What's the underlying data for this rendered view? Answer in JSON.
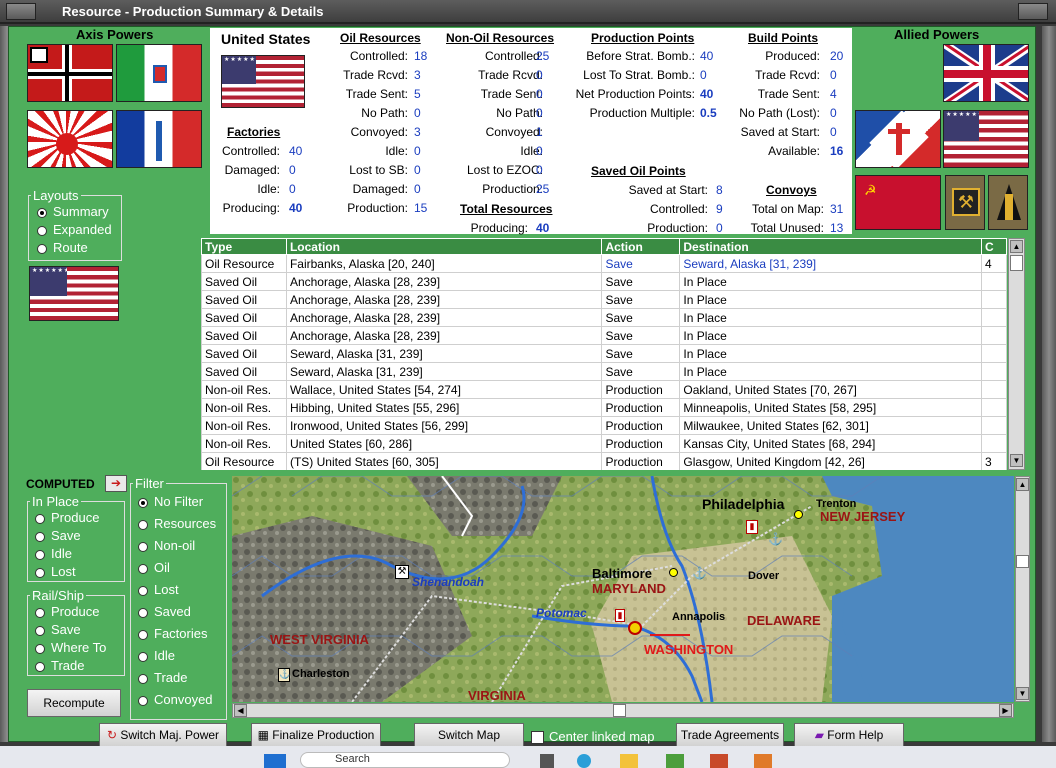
{
  "window": {
    "title": "Resource - Production Summary & Details"
  },
  "axis": {
    "title": "Axis Powers"
  },
  "allied": {
    "title": "Allied Powers"
  },
  "layouts": {
    "legend": "Layouts",
    "options": [
      "Summary",
      "Expanded",
      "Route"
    ],
    "selected": "Summary"
  },
  "summary": {
    "country": "United States",
    "factories": {
      "title": "Factories",
      "rows": [
        {
          "label": "Controlled:",
          "value": "40"
        },
        {
          "label": "Damaged:",
          "value": "0"
        },
        {
          "label": "Idle:",
          "value": "0"
        },
        {
          "label": "Producing:",
          "value": "40"
        }
      ]
    },
    "oil": {
      "title": "Oil Resources",
      "rows": [
        {
          "label": "Controlled:",
          "value": "18"
        },
        {
          "label": "Trade Rcvd:",
          "value": "3"
        },
        {
          "label": "Trade Sent:",
          "value": "5"
        },
        {
          "label": "No Path:",
          "value": "0"
        },
        {
          "label": "Convoyed:",
          "value": "3"
        },
        {
          "label": "Idle:",
          "value": "0"
        },
        {
          "label": "Lost to SB:",
          "value": "0"
        },
        {
          "label": "Damaged:",
          "value": "0"
        },
        {
          "label": "Production:",
          "value": "15"
        }
      ]
    },
    "nonoil": {
      "title": "Non-Oil Resources",
      "rows": [
        {
          "label": "Controlled:",
          "value": "25"
        },
        {
          "label": "Trade Rcvd:",
          "value": "0"
        },
        {
          "label": "Trade Sent:",
          "value": "0"
        },
        {
          "label": "No Path:",
          "value": "0"
        },
        {
          "label": "Convoyed:",
          "value": "1"
        },
        {
          "label": "Idle:",
          "value": "0"
        },
        {
          "label": "Lost to EZOC:",
          "value": "0"
        },
        {
          "label": "Production:",
          "value": "25"
        }
      ]
    },
    "total": {
      "title": "Total Resources",
      "label": "Producing:",
      "value": "40"
    },
    "pp": {
      "title": "Production Points",
      "rows": [
        {
          "label": "Before Strat. Bomb.:",
          "value": "40"
        },
        {
          "label": "Lost To Strat. Bomb.:",
          "value": "0"
        },
        {
          "label": "Net Production Points:",
          "value": "40"
        },
        {
          "label": "Production Multiple:",
          "value": "0.5"
        }
      ]
    },
    "savedoil": {
      "title": "Saved Oil Points",
      "rows": [
        {
          "label": "Saved at Start:",
          "value": "8"
        },
        {
          "label": "Controlled:",
          "value": "9"
        },
        {
          "label": "Production:",
          "value": "0"
        }
      ]
    },
    "build": {
      "title": "Build Points",
      "rows": [
        {
          "label": "Produced:",
          "value": "20"
        },
        {
          "label": "Trade Rcvd:",
          "value": "0"
        },
        {
          "label": "Trade Sent:",
          "value": "4"
        },
        {
          "label": "No Path (Lost):",
          "value": "0"
        },
        {
          "label": "Saved at Start:",
          "value": "0"
        },
        {
          "label": "Available:",
          "value": "16"
        }
      ]
    },
    "convoys": {
      "title": "Convoys",
      "rows": [
        {
          "label": "Total on Map:",
          "value": "31"
        },
        {
          "label": "Total Unused:",
          "value": "13"
        }
      ]
    }
  },
  "table": {
    "headers": [
      "Type",
      "Location",
      "Action",
      "Destination",
      "C"
    ],
    "rows": [
      [
        "Oil Resource",
        "Fairbanks, Alaska [20, 240]",
        "Save",
        "Seward, Alaska [31, 239]",
        "4"
      ],
      [
        "Saved Oil",
        "Anchorage, Alaska [28, 239]",
        "Save",
        "In Place",
        ""
      ],
      [
        "Saved Oil",
        "Anchorage, Alaska [28, 239]",
        "Save",
        "In Place",
        ""
      ],
      [
        "Saved Oil",
        "Anchorage, Alaska [28, 239]",
        "Save",
        "In Place",
        ""
      ],
      [
        "Saved Oil",
        "Anchorage, Alaska [28, 239]",
        "Save",
        "In Place",
        ""
      ],
      [
        "Saved Oil",
        "Seward, Alaska [31, 239]",
        "Save",
        "In Place",
        ""
      ],
      [
        "Saved Oil",
        "Seward, Alaska [31, 239]",
        "Save",
        "In Place",
        ""
      ],
      [
        "Non-oil Res.",
        "Wallace, United States [54, 274]",
        "Production",
        "Oakland, United States [70, 267]",
        ""
      ],
      [
        "Non-oil Res.",
        "Hibbing, United States [55, 296]",
        "Production",
        "Minneapolis, United States [58, 295]",
        ""
      ],
      [
        "Non-oil Res.",
        "Ironwood, United States [56, 299]",
        "Production",
        "Milwaukee, United States [62, 301]",
        ""
      ],
      [
        "Non-oil Res.",
        "United States [60, 286]",
        "Production",
        "Kansas City, United States [68, 294]",
        ""
      ],
      [
        "Oil Resource",
        "(TS) United States [60, 305]",
        "Production",
        "Glasgow, United Kingdom [42, 26]",
        "3"
      ]
    ]
  },
  "computed": {
    "label": "COMPUTED"
  },
  "inplace": {
    "legend": "In Place",
    "options": [
      "Produce",
      "Save",
      "Idle",
      "Lost"
    ]
  },
  "railship": {
    "legend": "Rail/Ship",
    "options": [
      "Produce",
      "Save",
      "Where To",
      "Trade"
    ]
  },
  "filter": {
    "legend": "Filter",
    "options": [
      "No Filter",
      "Resources",
      "Non-oil",
      "Oil",
      "Lost",
      "Saved",
      "Factories",
      "Idle",
      "Trade",
      "Convoyed"
    ],
    "selected": "No Filter"
  },
  "recompute": "Recompute",
  "map": {
    "labels": [
      "Philadelphia",
      "Trenton",
      "NEW JERSEY",
      "Dover",
      "Baltimore",
      "MARYLAND",
      "Shenandoah",
      "Potomac",
      "Annapolis",
      "DELAWARE",
      "WEST VIRGINIA",
      "WASHINGTON",
      "Charleston",
      "VIRGINIA"
    ]
  },
  "buttons": {
    "switch_power": "Switch Maj. Power",
    "finalize": "Finalize Production",
    "switch_map": "Switch Map",
    "center_linked": "Center linked map",
    "trade": "Trade Agreements",
    "help": "Form Help"
  },
  "taskbar": {
    "search": "Search"
  },
  "colors": {
    "panel_green": "#4fae5c",
    "header_green": "#3a8c43",
    "link_blue": "#1a3dbf",
    "map_red": "#b01818"
  }
}
